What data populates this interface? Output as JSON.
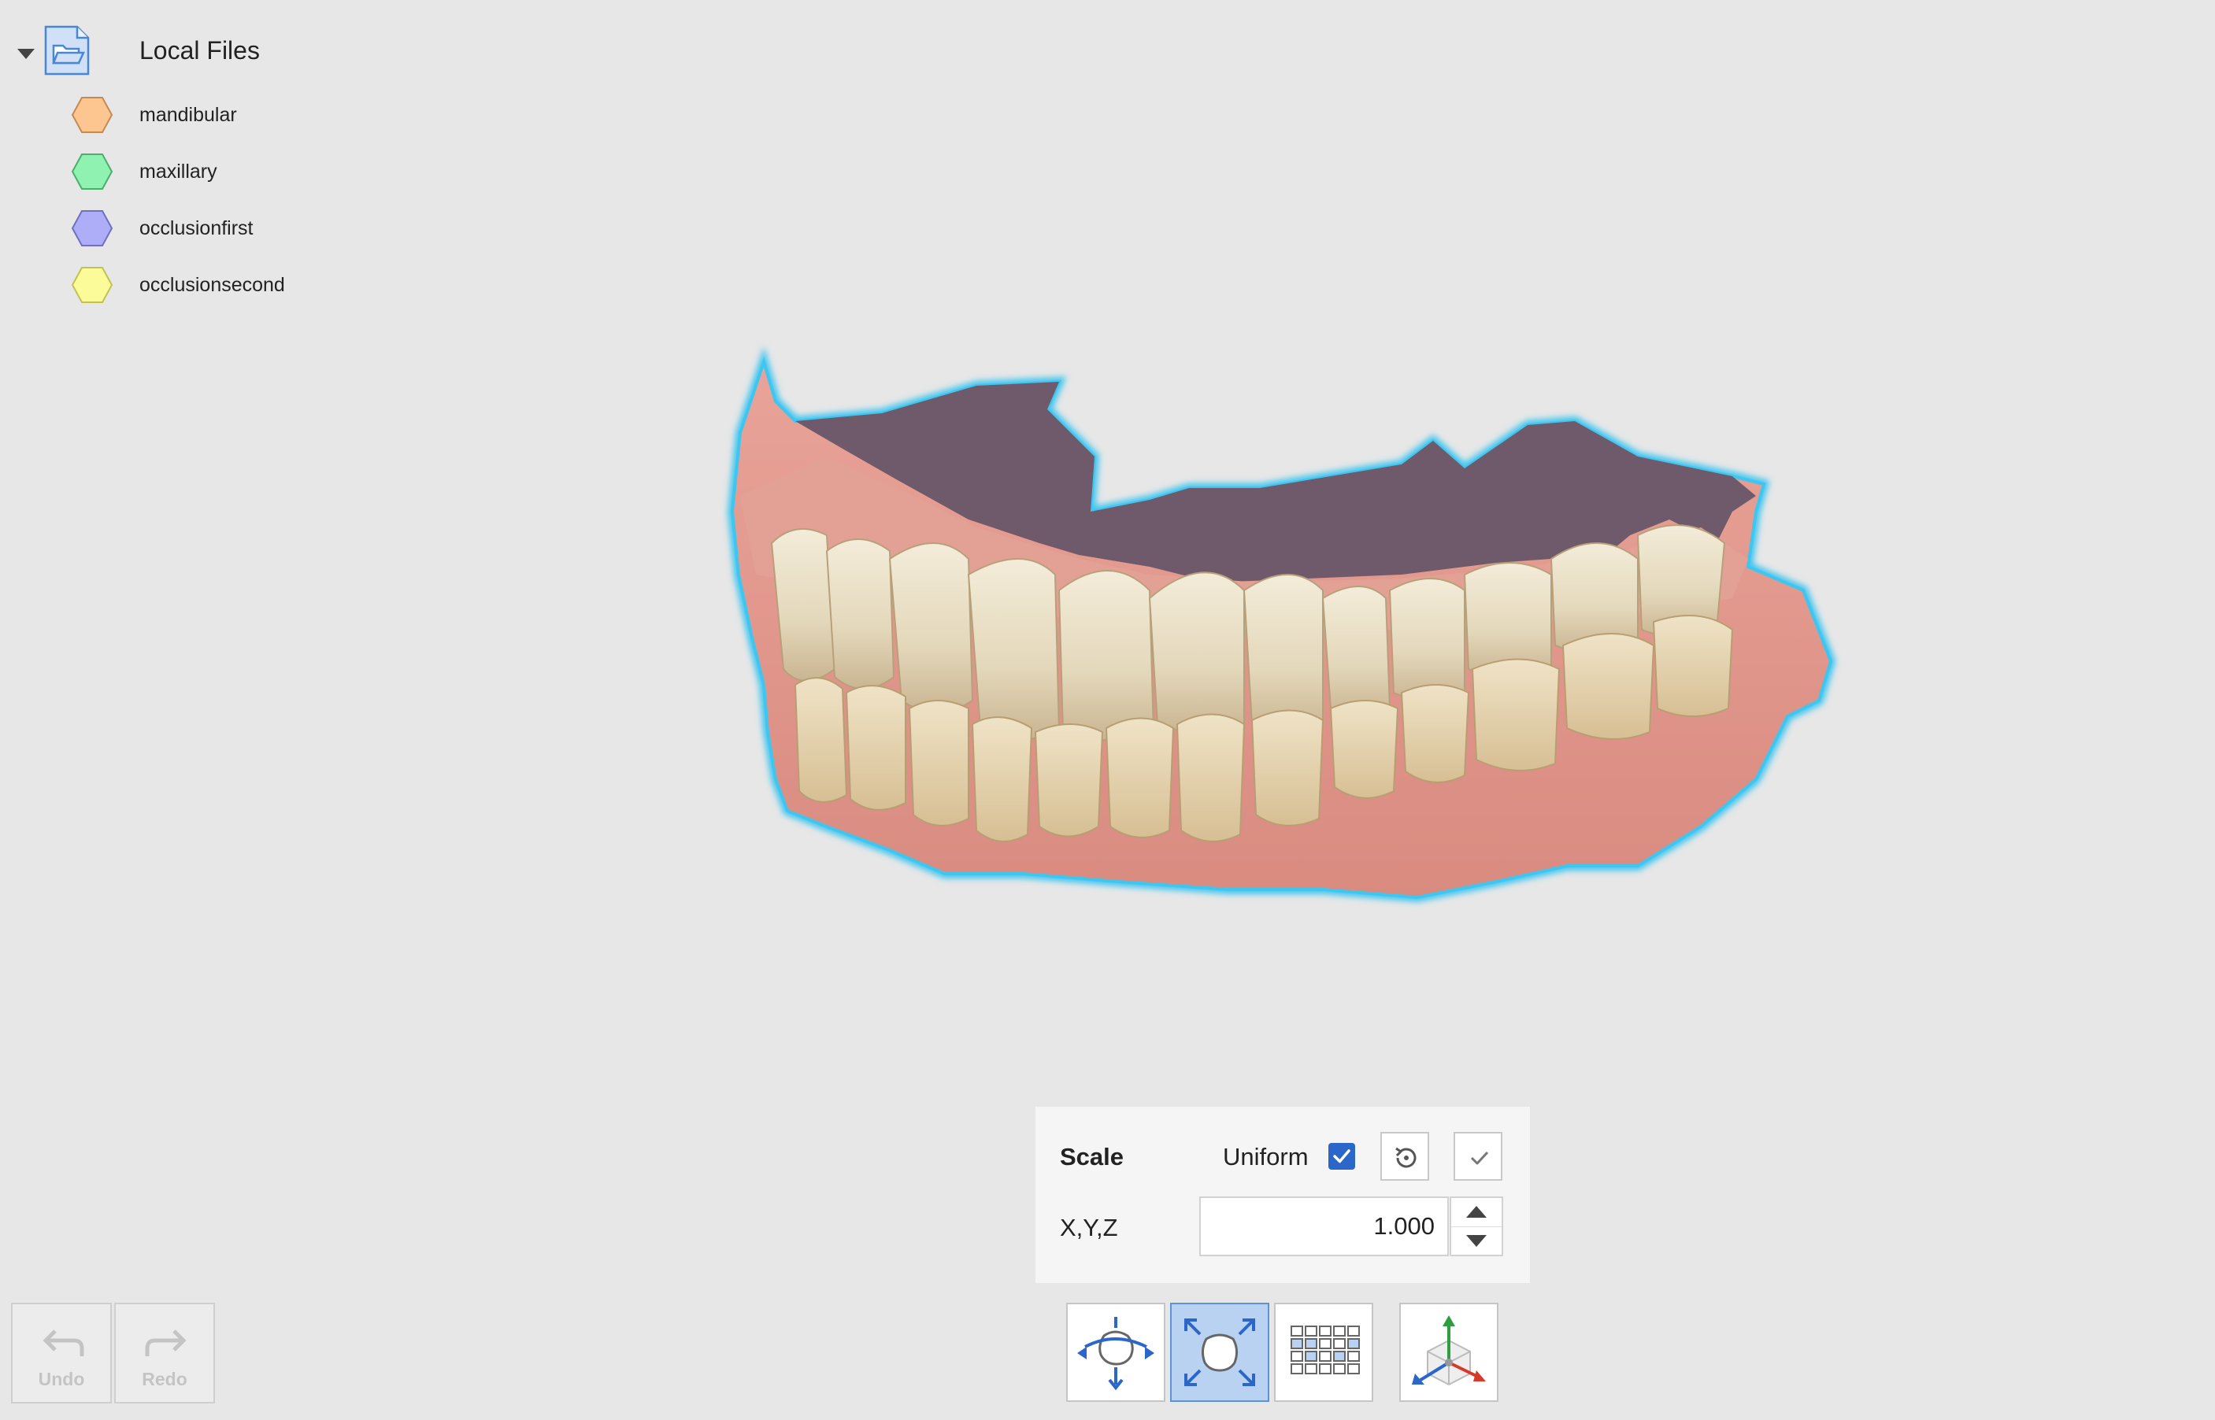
{
  "tree": {
    "root_label": "Local Files",
    "items": [
      {
        "label": "mandibular",
        "color": "#fdc690"
      },
      {
        "label": "maxillary",
        "color": "#8ff2b0"
      },
      {
        "label": "occlusionfirst",
        "color": "#aeaef8"
      },
      {
        "label": "occlusionsecond",
        "color": "#fbfb9a"
      }
    ]
  },
  "scale_panel": {
    "title": "Scale",
    "uniform_label": "Uniform",
    "uniform_checked": true,
    "xyz_label": "X,Y,Z",
    "xyz_value": "1.000"
  },
  "toolbar": {
    "undo_label": "Undo",
    "redo_label": "Redo",
    "active_tool": "scale"
  },
  "colors": {
    "accent": "#2a67c9",
    "selection_outline": "#3fc6f0",
    "background": "#e7e7e7"
  }
}
